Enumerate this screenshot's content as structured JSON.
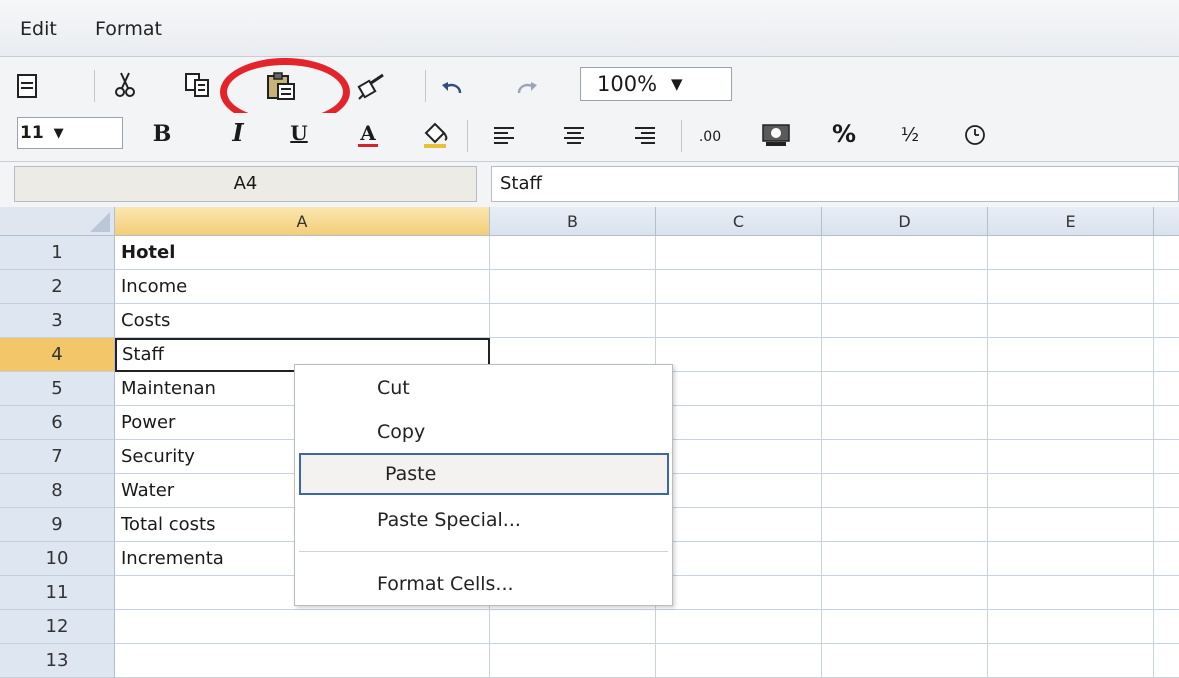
{
  "menu": {
    "edit": "Edit",
    "format": "Format"
  },
  "toolbar": {
    "zoom_value": "100%",
    "font_size_value": "11",
    "decimal_label": ".00",
    "percent_label": "%",
    "fraction_label": "½"
  },
  "formula_bar": {
    "cell_ref": "A4",
    "content": "Staff"
  },
  "columns": [
    "A",
    "B",
    "C",
    "D",
    "E"
  ],
  "rows": [
    {
      "num": "1",
      "a": "Hotel"
    },
    {
      "num": "2",
      "a": "Income"
    },
    {
      "num": "3",
      "a": "Costs"
    },
    {
      "num": "4",
      "a": "Staff"
    },
    {
      "num": "5",
      "a": "Maintenan"
    },
    {
      "num": "6",
      "a": "Power"
    },
    {
      "num": "7",
      "a": "Security"
    },
    {
      "num": "8",
      "a": "Water"
    },
    {
      "num": "9",
      "a": "Total costs"
    },
    {
      "num": "10",
      "a": "Incrementa"
    },
    {
      "num": "11",
      "a": ""
    },
    {
      "num": "12",
      "a": ""
    },
    {
      "num": "13",
      "a": ""
    }
  ],
  "context_menu": {
    "cut": "Cut",
    "copy": "Copy",
    "paste": "Paste",
    "paste_special": "Paste Special...",
    "format_cells": "Format Cells..."
  },
  "colors": {
    "highlight_ring": "#e3242b",
    "selected_header": "#f3c66a",
    "menu_focus": "#3d66a8"
  }
}
